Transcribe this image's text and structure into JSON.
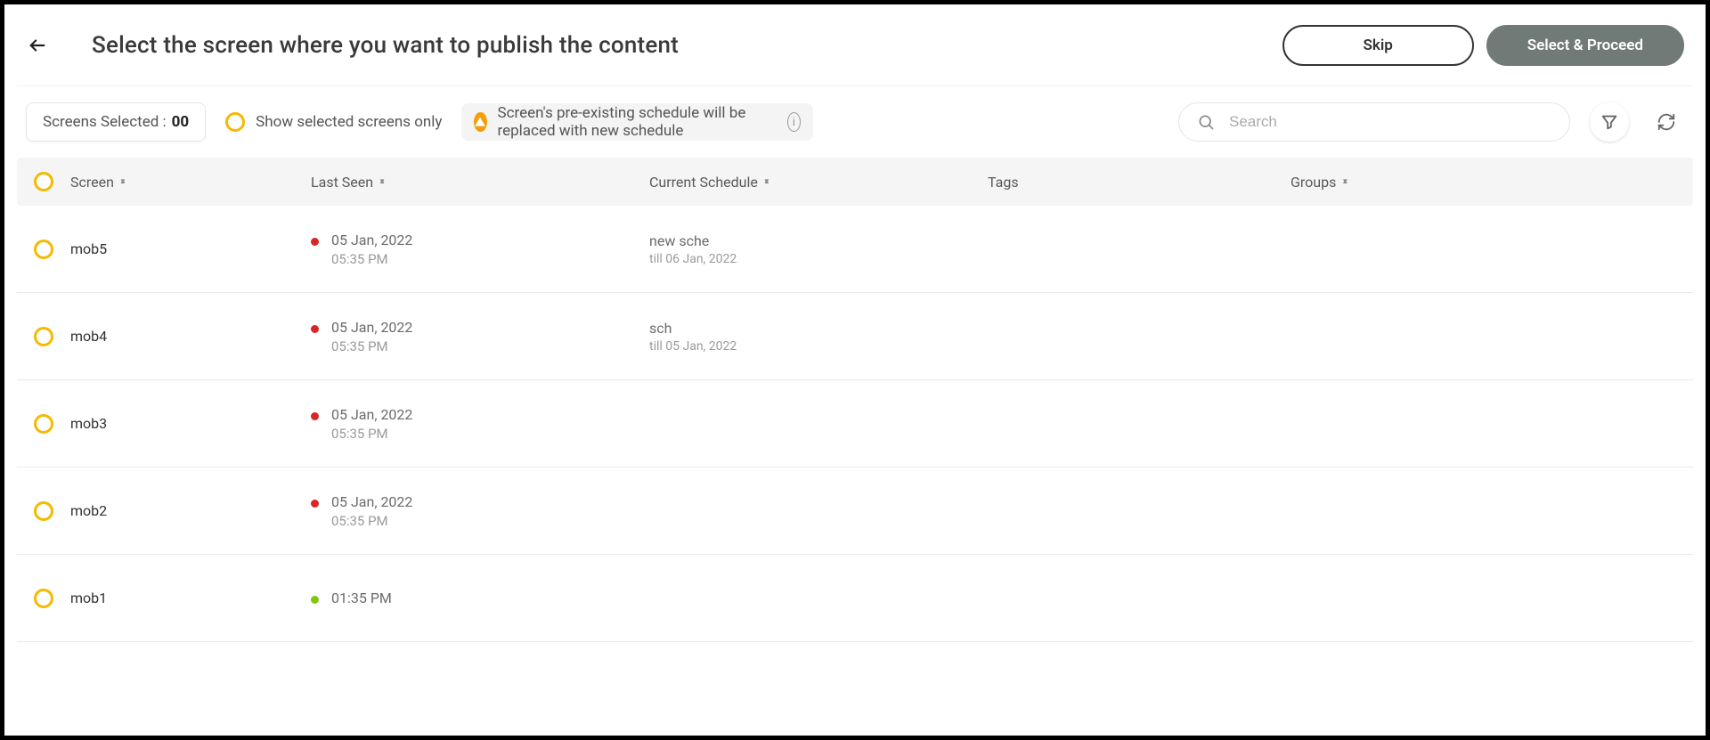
{
  "header": {
    "title": "Select the screen where you want to publish the content",
    "skip": "Skip",
    "proceed": "Select & Proceed"
  },
  "toolbar": {
    "selected_label": "Screens Selected :",
    "selected_count": "00",
    "show_selected_only": "Show selected screens only",
    "notice": "Screen's pre-existing schedule will be replaced with new schedule",
    "search_placeholder": "Search"
  },
  "columns": {
    "screen": "Screen",
    "last_seen": "Last Seen",
    "schedule": "Current Schedule",
    "tags": "Tags",
    "groups": "Groups"
  },
  "rows": [
    {
      "name": "mob5",
      "status": "red",
      "last_seen_date": "05 Jan, 2022",
      "last_seen_time": "05:35 PM",
      "schedule_name": "new sche",
      "schedule_sub": "till 06 Jan, 2022"
    },
    {
      "name": "mob4",
      "status": "red",
      "last_seen_date": "05 Jan, 2022",
      "last_seen_time": "05:35 PM",
      "schedule_name": "sch",
      "schedule_sub": "till 05 Jan, 2022"
    },
    {
      "name": "mob3",
      "status": "red",
      "last_seen_date": "05 Jan, 2022",
      "last_seen_time": "05:35 PM",
      "schedule_name": "",
      "schedule_sub": ""
    },
    {
      "name": "mob2",
      "status": "red",
      "last_seen_date": "05 Jan, 2022",
      "last_seen_time": "05:35 PM",
      "schedule_name": "",
      "schedule_sub": ""
    },
    {
      "name": "mob1",
      "status": "green",
      "last_seen_date": "",
      "last_seen_time": "01:35 PM",
      "schedule_name": "",
      "schedule_sub": ""
    }
  ]
}
